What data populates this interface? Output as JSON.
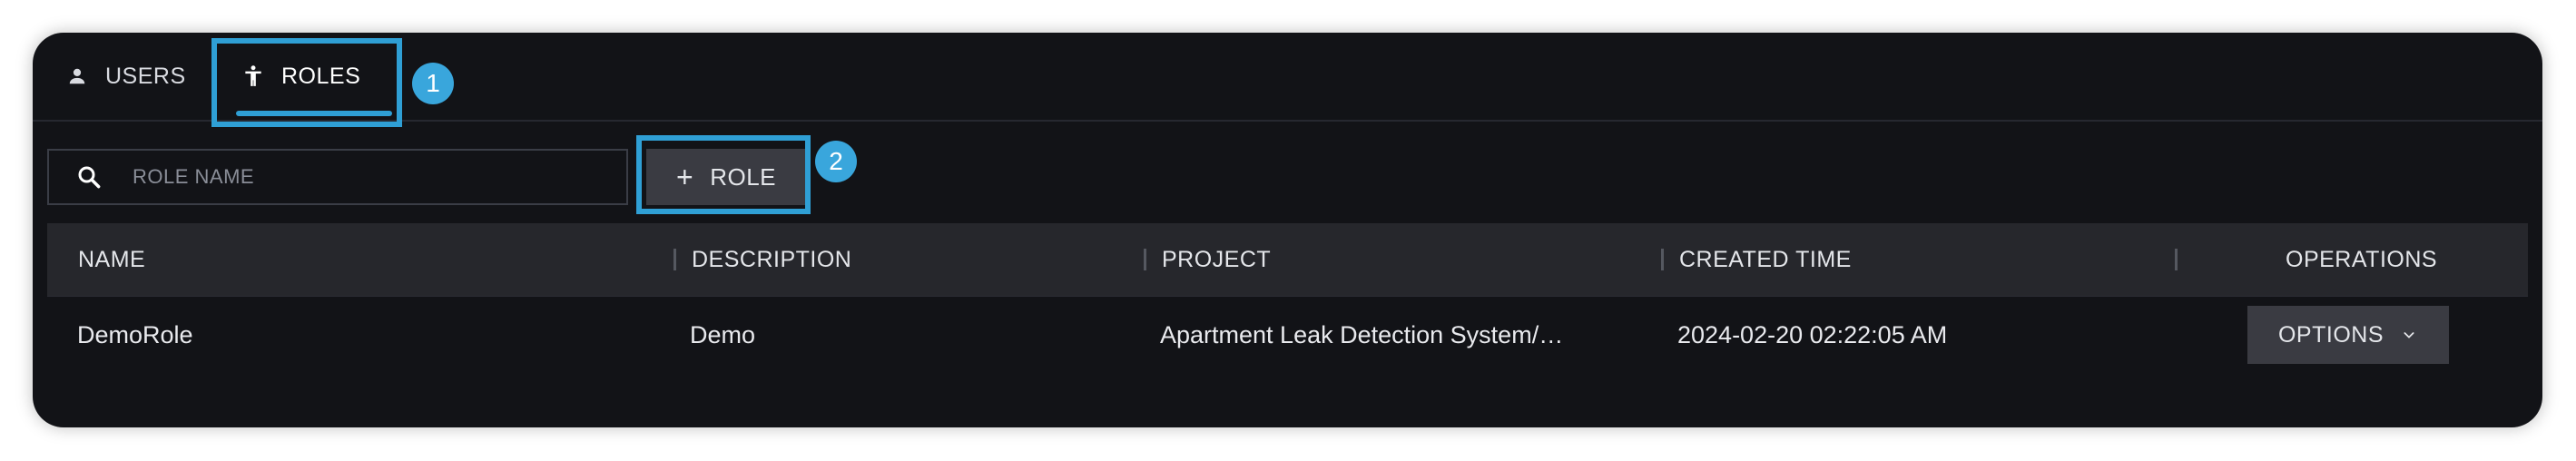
{
  "tabs": [
    {
      "label": "USERS",
      "icon": "person-icon"
    },
    {
      "label": "ROLES",
      "icon": "accessibility-icon"
    }
  ],
  "search": {
    "placeholder": "ROLE NAME",
    "value": "",
    "icon": "search-icon"
  },
  "toolbar": {
    "add_role_label": "ROLE",
    "add_icon": "plus-icon"
  },
  "annotations": [
    {
      "number": "1"
    },
    {
      "number": "2"
    }
  ],
  "table": {
    "columns": [
      "NAME",
      "DESCRIPTION",
      "PROJECT",
      "CREATED TIME",
      "OPERATIONS"
    ],
    "rows": [
      {
        "name": "DemoRole",
        "description": "Demo",
        "project": "Apartment Leak Detection System/…",
        "created_time": "2024-02-20 02:22:05 AM",
        "operations_label": "OPTIONS"
      }
    ]
  },
  "colors": {
    "accent": "#2f9fd5",
    "badge": "#39a6dc",
    "panel_bg": "#121317",
    "header_bg": "#26272c",
    "button_bg": "#3a3b42"
  }
}
